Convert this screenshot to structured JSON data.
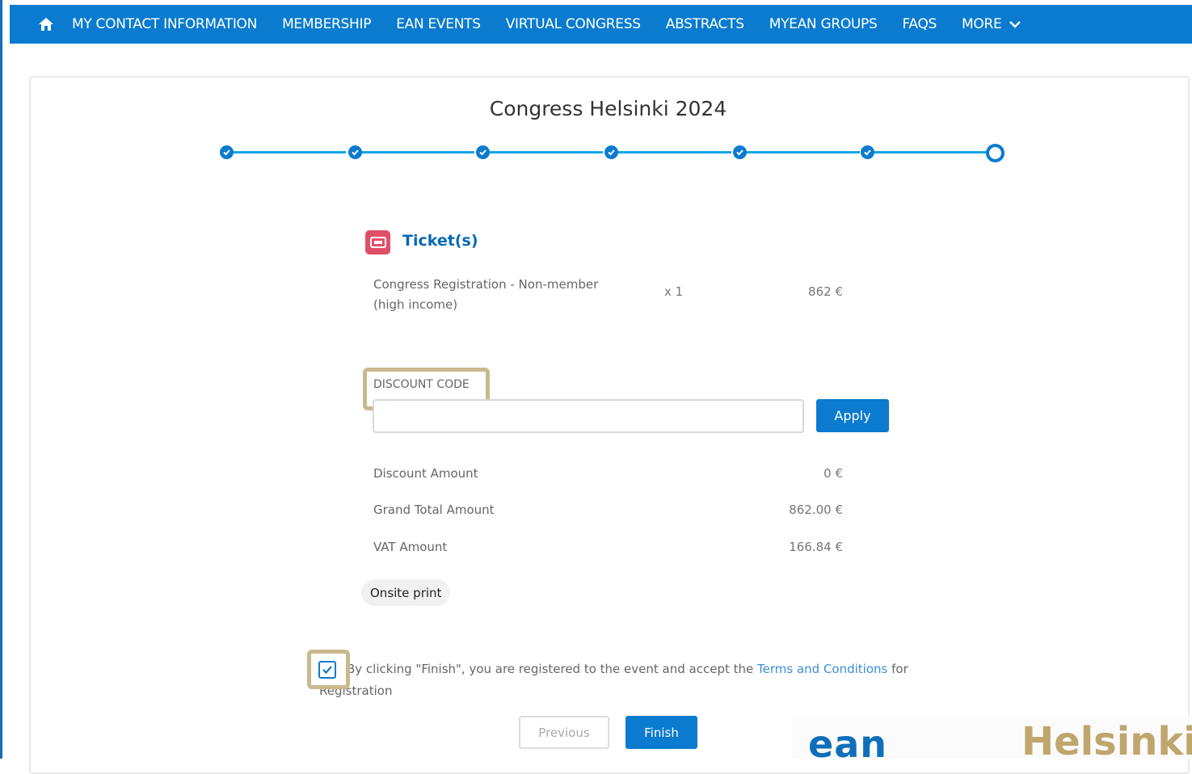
{
  "nav": {
    "items": [
      "MY CONTACT INFORMATION",
      "MEMBERSHIP",
      "EAN EVENTS",
      "VIRTUAL CONGRESS",
      "ABSTRACTS",
      "MYEAN GROUPS",
      "FAQS"
    ],
    "more_label": "MORE"
  },
  "page": {
    "title": "Congress Helsinki 2024"
  },
  "steps": {
    "total": 7,
    "completed": 6
  },
  "tickets": {
    "heading": "Ticket(s)",
    "item": {
      "name": "Congress Registration - Non-member (high income)",
      "quantity": "x 1",
      "price": "862 €"
    }
  },
  "discount": {
    "label": "DISCOUNT CODE",
    "value": "",
    "apply_label": "Apply"
  },
  "summary": {
    "discount_label": "Discount Amount",
    "discount_value": "0 €",
    "grand_total_label": "Grand Total Amount",
    "grand_total_value": "862.00 €",
    "vat_label": "VAT Amount",
    "vat_value": "166.84 €"
  },
  "onsite_print": "Onsite print",
  "terms": {
    "checked": true,
    "text_before": "By clicking \"Finish\", you are registered to the event and accept the ",
    "link": "Terms and Conditions",
    "text_after": " for Registration"
  },
  "buttons": {
    "previous": "Previous",
    "finish": "Finish"
  },
  "logos": {
    "ean": "ean",
    "helsinki": "Helsinki"
  },
  "colors": {
    "primary": "#0a7bcf",
    "step_line": "#12a7e8",
    "ticket_icon": "#e04f68",
    "highlight": "#c9b98f"
  }
}
